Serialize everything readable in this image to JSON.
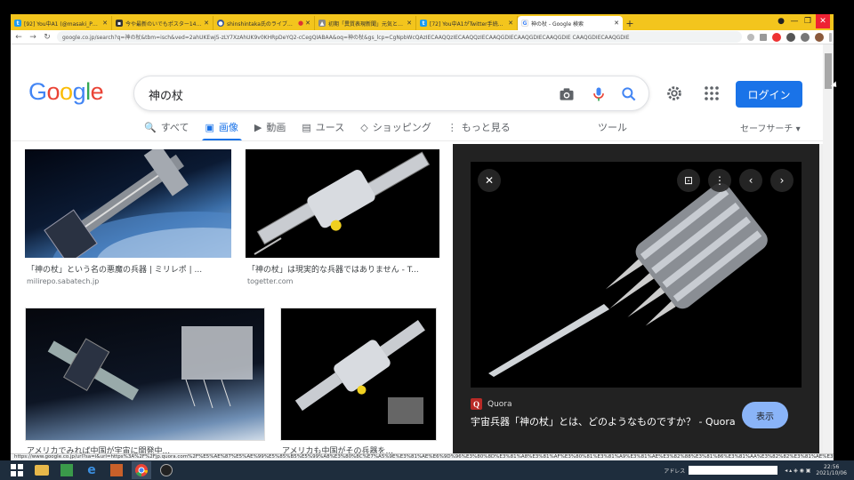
{
  "browser": {
    "tabs": [
      {
        "title": "[92] You中A1 (@masaki_PT) / Tw",
        "favicon": "twitter",
        "color": "#1d9bf0"
      },
      {
        "title": "今や最新のいでもポスター14保存",
        "favicon": "page",
        "color": "#333"
      },
      {
        "title": "shinshintaka氏のライブ配信",
        "favicon": "live",
        "color": "#3b5998"
      },
      {
        "title": "初期「異質表現新聞」元気とはこ",
        "favicon": "page",
        "color": "#555"
      },
      {
        "title": "[72] You中A1がTwitter手続ていく",
        "favicon": "twitter",
        "color": "#1d9bf0"
      },
      {
        "title": "神の杖 - Google 検索",
        "favicon": "google",
        "color": "#4285f4",
        "active": true
      }
    ],
    "newtab": "+",
    "address": "google.co.jp/search?q=神の杖&tbm=isch&ved=2ahUKEwj5-zLY7XzAhUK9v0KHRpDeYQ2-cCegQIABAA&oq=神の杖&gs_lcp=CgNpbWcQAzIECAAQQzIECAAQQzIECAAQGDIECAAQGDIECAAQGDIE CAAQGDIECAAQGDIE",
    "status_url": "https://www.google.co.jp/url?sa=i&url=https%3A%2F%2Fjp.quora.com%2F%E5%AE%87%E5%AE%99%E5%85%B5%E5%99%A8%E3%80%8C%E7%A5%9E%E3%81%AE%E6%9D%96%E3%80%8D%E3%81%A8%E3%81%AF%E3%80%81%E3%81%A9%E3%81%AE%E3%82%88%E3%81%86%E3%81%AA%E3%82%82%E3%81%AE%E3%81%A7%E3%81%99%E3%81%8B"
  },
  "google": {
    "logo": "Google",
    "query": "神の杖",
    "login": "ログイン",
    "nav": [
      {
        "label": "すべて",
        "icon": "🔍"
      },
      {
        "label": "画像",
        "icon": "▣",
        "active": true
      },
      {
        "label": "動画",
        "icon": "▶"
      },
      {
        "label": "ユース",
        "icon": "▤"
      },
      {
        "label": "ショッピング",
        "icon": "◇"
      },
      {
        "label": "もっと見る",
        "icon": "⋮"
      }
    ],
    "tools": "ツール",
    "safesearch": "セーフサーチ ▾"
  },
  "results": [
    {
      "title": "「神の杖」という名の悪魔の兵器 | ミリレポ | ...",
      "site": "milirepo.sabatech.jp"
    },
    {
      "title": "「神の杖」は現実的な兵器ではありません - T...",
      "site": "togetter.com"
    },
    {
      "title": "アメリカでみれば中国が宇宙に開発中...",
      "site": ""
    },
    {
      "title": "アメリカも中国がその兵器を...",
      "site": ""
    }
  ],
  "preview": {
    "source": "Quora",
    "title": "宇宙兵器「神の杖」とは、どのようなものですか？ - Quora",
    "view": "表示"
  },
  "taskbar": {
    "address_label": "アドレス",
    "time": "22:56",
    "date": "2021/10/06"
  }
}
